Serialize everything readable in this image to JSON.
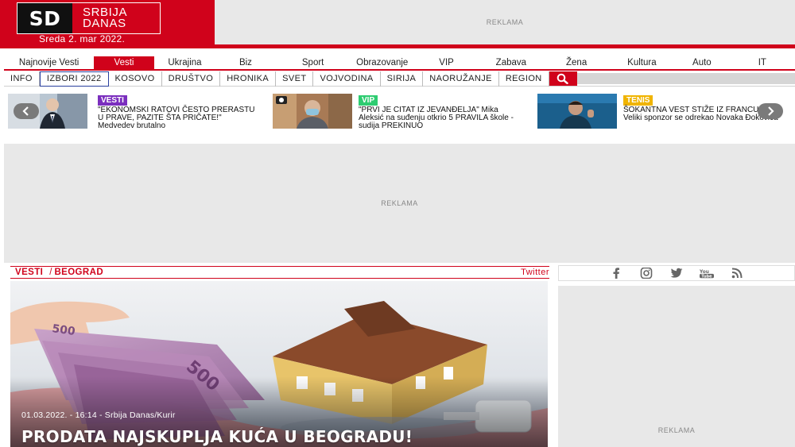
{
  "header": {
    "logo_initials": "SD",
    "logo_word1": "SRBIJA",
    "logo_word2": "DANAS",
    "date": "Sreda 2. mar 2022.",
    "ad_label": "REKLAMA"
  },
  "nav_primary": [
    {
      "label": "Najnovije Vesti",
      "active": false
    },
    {
      "label": "Vesti",
      "active": true
    },
    {
      "label": "Ukrajina",
      "active": false
    },
    {
      "label": "Biz",
      "active": false
    },
    {
      "label": "Sport",
      "active": false
    },
    {
      "label": "Obrazovanje",
      "active": false
    },
    {
      "label": "VIP",
      "active": false
    },
    {
      "label": "Zabava",
      "active": false
    },
    {
      "label": "Žena",
      "active": false
    },
    {
      "label": "Kultura",
      "active": false
    },
    {
      "label": "Auto",
      "active": false
    },
    {
      "label": "IT",
      "active": false
    }
  ],
  "nav_secondary": [
    {
      "label": "INFO",
      "boxed": false
    },
    {
      "label": "IZBORI 2022",
      "boxed": true
    },
    {
      "label": "KOSOVO",
      "boxed": false
    },
    {
      "label": "DRUŠTVO",
      "boxed": false
    },
    {
      "label": "HRONIKA",
      "boxed": false
    },
    {
      "label": "SVET",
      "boxed": false
    },
    {
      "label": "VOJVODINA",
      "boxed": false
    },
    {
      "label": "SIRIJA",
      "boxed": false
    },
    {
      "label": "NAORUŽANJE",
      "boxed": false
    },
    {
      "label": "REGION",
      "boxed": false
    }
  ],
  "carousel": [
    {
      "tag": "VESTI",
      "tag_color": "#7b2fbe",
      "text": "\"EKONOMSKI RATOVI ČESTO PRERASTU U PRAVE, PAZITE ŠTA PRIČATE!\" Medvedev brutalno"
    },
    {
      "tag": "VIP",
      "tag_color": "#2ecc71",
      "text": "\"PRVI JE CITAT IZ JEVANĐELJA\" Mika Aleksić na suđenju otkrio 5 PRAVILA škole - sudija PREKINUO"
    },
    {
      "tag": "TENIS",
      "tag_color": "#f0b400",
      "text": "ŠOKANTNA VEST STIŽE IZ FRANCUSKE: Veliki sponzor se odrekao Novaka Đokovića"
    }
  ],
  "ads": {
    "big": "REKLAMA",
    "side": "REKLAMA"
  },
  "article": {
    "crumb1": "VESTI",
    "crumb_sep": "/",
    "crumb2": "BEOGRAD",
    "twitter": "Twitter",
    "meta": "01.03.2022. - 16:14 - Srbija Danas/Kurir",
    "title": "PRODATA NAJSKUPLJA KUĆA U BEOGRADU!"
  },
  "social_icons": [
    "facebook-icon",
    "instagram-icon",
    "twitter-icon",
    "youtube-icon",
    "rss-icon"
  ]
}
